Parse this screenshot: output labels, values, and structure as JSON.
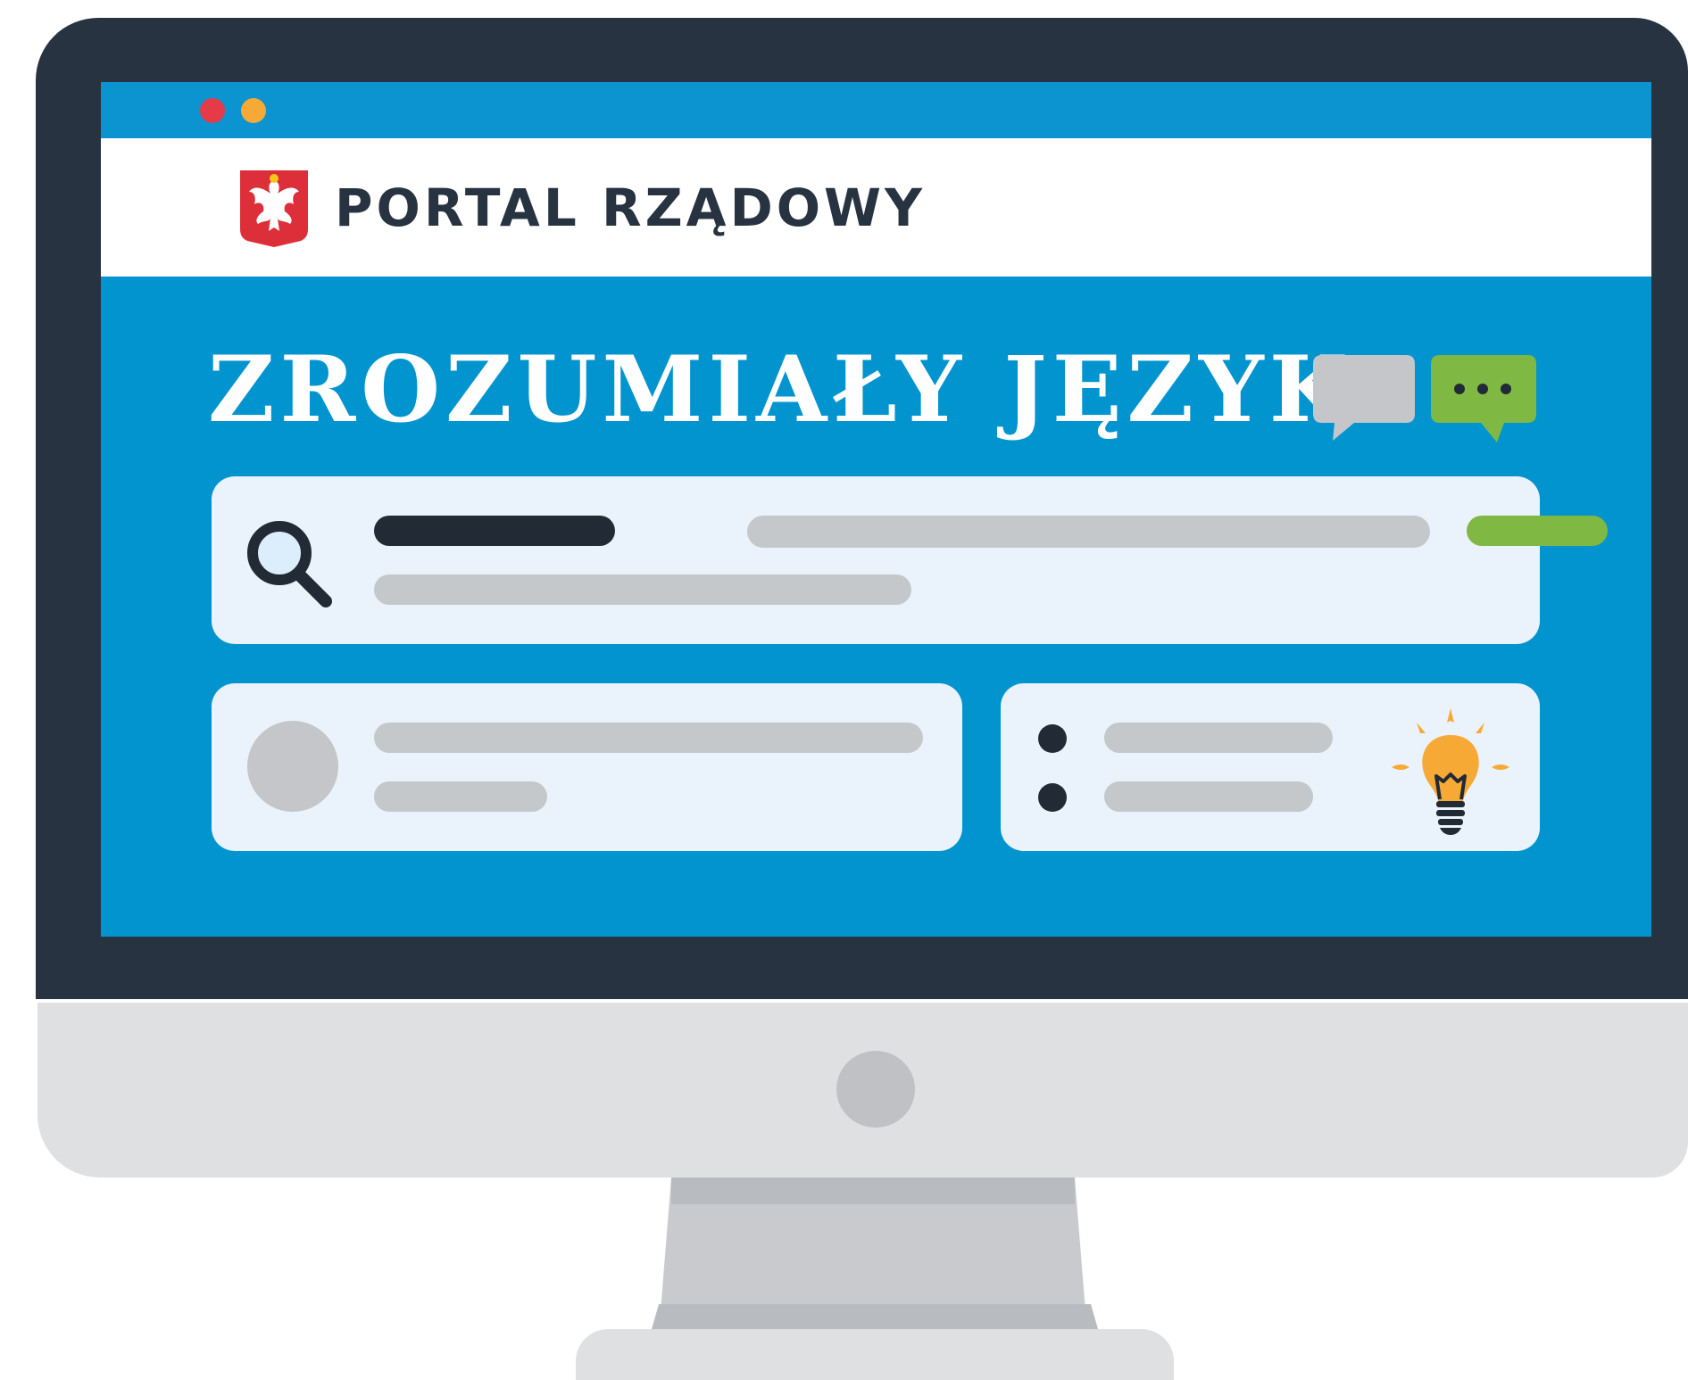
{
  "window": {
    "controls": [
      {
        "name": "close",
        "color": "#e53a47"
      },
      {
        "name": "minimize",
        "color": "#f7a935"
      }
    ]
  },
  "header": {
    "logo_icon": "polish-eagle-emblem-icon",
    "title": "PORTAL RZĄDOWY"
  },
  "hero": {
    "title": "ZROZUMIAŁY JĘZYK",
    "icons": [
      "speech-bubble-icon",
      "chat-typing-icon"
    ]
  },
  "search_card": {
    "icon": "search-icon"
  },
  "info_cards": {
    "profile_avatar": "avatar",
    "list_icon": "lightbulb-icon"
  },
  "colors": {
    "screen": "#0194cf",
    "titlebar": "#0b94cf",
    "bezel": "#283341",
    "card": "#eaf3fb",
    "placeholder": "#c4c8cb",
    "accent_green": "#7fb843",
    "accent_orange": "#f7a935",
    "dark": "#222a35"
  }
}
